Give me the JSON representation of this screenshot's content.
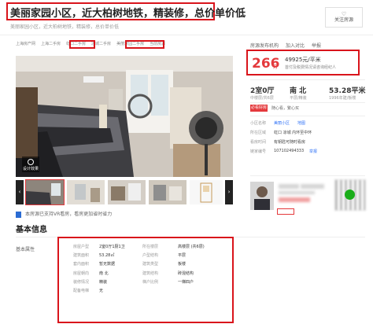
{
  "header": {
    "title": "美丽家园小区，近大柏树地铁，精装修，总价单价低",
    "subtitle": "美丽家园小区，近大柏树地铁，精装修，总价单价低",
    "follow_label": "关注房源"
  },
  "breadcrumb": [
    "上海房产网",
    "上海二手房",
    "虹口二手房",
    "凉城二手房",
    "美丽家园二手房",
    "当前房源"
  ],
  "top_actions": [
    "房源发布机构",
    "加入对比",
    "举报"
  ],
  "gallery": {
    "vr_badge_label": "设计效果",
    "prev_icon": "chevron-left-icon",
    "next_icon": "chevron-right-icon",
    "vr_notice": "本房源已支持VR看房，看房更加省时省力"
  },
  "price": {
    "total": "266",
    "unit": "万",
    "per_sqm": "49925元/平米",
    "note": "首付及税费情况请咨询经纪人"
  },
  "facts": [
    {
      "main": "2室0厅",
      "sub": "中楼层/共6层"
    },
    {
      "main": "南 北",
      "sub": "平层/精装"
    },
    {
      "main": "53.28平米",
      "sub": "1996年建/板楼"
    }
  ],
  "tags": {
    "badge": "必看好房",
    "text": "随心看，繁心买"
  },
  "location": {
    "community_label": "小区名称",
    "community_value": "美丽小区",
    "map_link": "地图",
    "area_label": "所在区域",
    "area_value": "虹口 凉城 内环至中环",
    "visit_label": "看房时间",
    "visit_value": "有钥匙可随时看房",
    "id_label": "链家编号",
    "id_value": "107102494333",
    "report_link": "举报"
  },
  "agent": {
    "qr_icon": "wechat-qr-icon"
  },
  "basic_info": {
    "section_title": "基本信息",
    "left_label": "基本属性",
    "attributes_left": [
      {
        "k": "房屋户型",
        "v": "2室0厅1厨1卫"
      },
      {
        "k": "建筑面积",
        "v": "53.28㎡"
      },
      {
        "k": "套内面积",
        "v": "暂无数据"
      },
      {
        "k": "房屋朝向",
        "v": "南 北"
      },
      {
        "k": "装修情况",
        "v": "精装"
      },
      {
        "k": "配备电梯",
        "v": "无"
      }
    ],
    "attributes_right": [
      {
        "k": "所在楼层",
        "v": "高楼层 (共6层)"
      },
      {
        "k": "户型结构",
        "v": "平层"
      },
      {
        "k": "建筑类型",
        "v": "板楼"
      },
      {
        "k": "建筑结构",
        "v": "砖混结构"
      },
      {
        "k": "梯户比例",
        "v": "一梯四户"
      }
    ]
  }
}
